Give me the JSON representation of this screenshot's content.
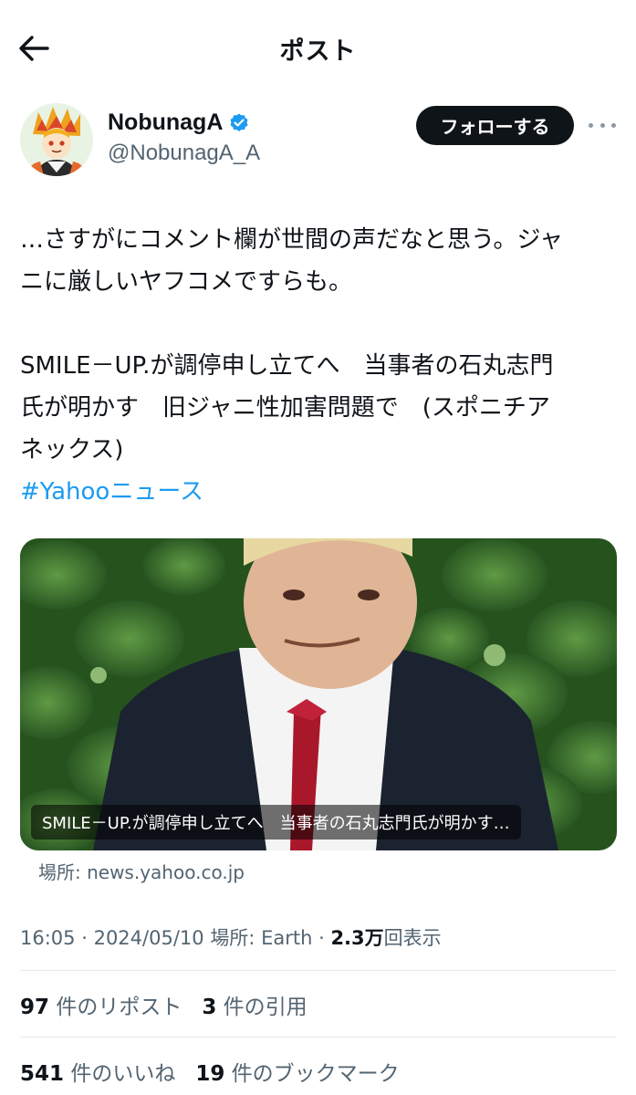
{
  "header": {
    "title": "ポスト"
  },
  "author": {
    "display_name": "NobunagA",
    "handle": "@NobunagA_A",
    "follow_label": "フォローする",
    "verified_color": "#1d9bf0"
  },
  "tweet": {
    "lines1": [
      "…さすがにコメント欄が世間の声だなと思う。ジャ",
      "ニに厳しいヤフコメですらも。"
    ],
    "lines2": [
      "SMILE－UP.が調停申し立てへ　当事者の石丸志門",
      "氏が明かす　旧ジャニ性加害問題で　(スポニチア",
      "ネックス)"
    ],
    "hashtag": "#Yahooニュース"
  },
  "card": {
    "caption": "SMILE－UP.が調停申し立てへ　当事者の石丸志門氏が明かす…",
    "source": "場所: news.yahoo.co.jp"
  },
  "meta": {
    "time": "16:05",
    "date": "2024/05/10",
    "location": "場所: Earth",
    "views_value": "2.3万",
    "views_label": "回表示"
  },
  "stats": {
    "reposts_value": "97",
    "reposts_label": "件のリポスト",
    "quotes_value": "3",
    "quotes_label": "件の引用",
    "likes_value": "541",
    "likes_label": "件のいいね",
    "bookmarks_value": "19",
    "bookmarks_label": "件のブックマーク"
  },
  "icons": [
    "arrow-left-icon",
    "verified-badge-icon",
    "more-icon"
  ],
  "colors": {
    "accent": "#1d9bf0",
    "text": "#0f1419",
    "secondary": "#536471"
  }
}
